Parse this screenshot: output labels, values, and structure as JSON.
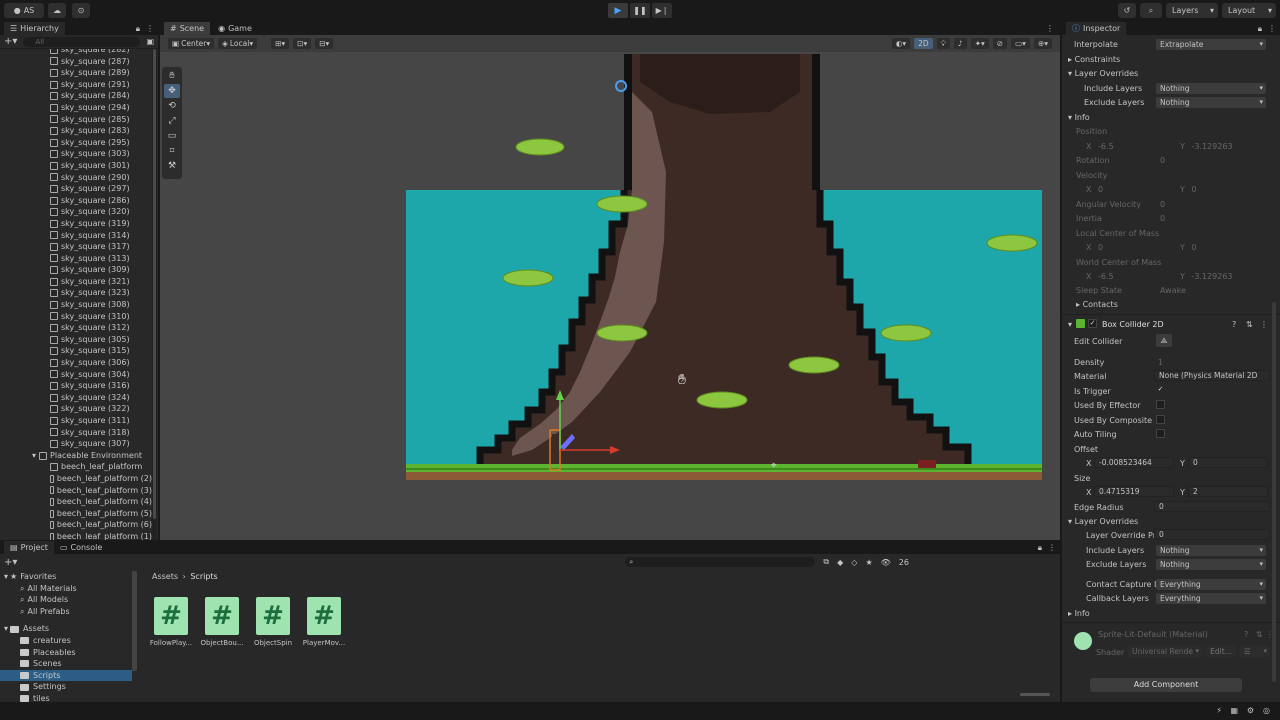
{
  "topbar": {
    "account": "AS",
    "layers_label": "Layers",
    "layout_label": "Layout"
  },
  "hierarchy": {
    "tab_label": "Hierarchy",
    "search_placeholder": "All",
    "items": [
      "sky_square (282)",
      "sky_square (287)",
      "sky_square (289)",
      "sky_square (291)",
      "sky_square (284)",
      "sky_square (294)",
      "sky_square (285)",
      "sky_square (283)",
      "sky_square (295)",
      "sky_square (303)",
      "sky_square (301)",
      "sky_square (290)",
      "sky_square (297)",
      "sky_square (286)",
      "sky_square (320)",
      "sky_square (319)",
      "sky_square (314)",
      "sky_square (317)",
      "sky_square (313)",
      "sky_square (309)",
      "sky_square (321)",
      "sky_square (323)",
      "sky_square (308)",
      "sky_square (310)",
      "sky_square (312)",
      "sky_square (305)",
      "sky_square (315)",
      "sky_square (306)",
      "sky_square (304)",
      "sky_square (316)",
      "sky_square (324)",
      "sky_square (322)",
      "sky_square (311)",
      "sky_square (318)",
      "sky_square (307)"
    ],
    "group_label": "Placeable Environment",
    "children": [
      "beech_leaf_platform",
      "beech_leaf_platform (2)",
      "beech_leaf_platform (3)",
      "beech_leaf_platform (4)",
      "beech_leaf_platform (5)",
      "beech_leaf_platform (6)",
      "beech_leaf_platform (1)"
    ]
  },
  "scene": {
    "tab_scene": "Scene",
    "tab_game": "Game",
    "pivot": "Center",
    "space": "Local",
    "mode_2d": "2D"
  },
  "inspector": {
    "tab_label": "Inspector",
    "interpolate_label": "Interpolate",
    "interpolate_value": "Extrapolate",
    "constraints_label": "Constraints",
    "layer_overrides_label": "Layer Overrides",
    "include_layers_label": "Include Layers",
    "include_layers_value": "Nothing",
    "exclude_layers_label": "Exclude Layers",
    "exclude_layers_value": "Nothing",
    "info_label": "Info",
    "position_label": "Position",
    "position_x": "-6.5",
    "position_y": "-3.129263",
    "rotation_label": "Rotation",
    "rotation_value": "0",
    "velocity_label": "Velocity",
    "velocity_x": "0",
    "velocity_y": "0",
    "angular_velocity_label": "Angular Velocity",
    "angular_velocity_value": "0",
    "inertia_label": "Inertia",
    "inertia_value": "0",
    "local_com_label": "Local Center of Mass",
    "local_com_x": "0",
    "local_com_y": "0",
    "world_com_label": "World Center of Mass",
    "world_com_x": "-6.5",
    "world_com_y": "-3.129263",
    "sleep_state_label": "Sleep State",
    "sleep_state_value": "Awake",
    "contacts_label": "Contacts",
    "box_collider_title": "Box Collider 2D",
    "edit_collider_label": "Edit Collider",
    "density_label": "Density",
    "density_value": "1",
    "material_label": "Material",
    "material_value": "None (Physics Material 2D",
    "is_trigger_label": "Is Trigger",
    "used_by_effector_label": "Used By Effector",
    "used_by_composite_label": "Used By Composite",
    "auto_tiling_label": "Auto Tiling",
    "offset_label": "Offset",
    "offset_x": "-0.008523464",
    "offset_y": "0",
    "size_label": "Size",
    "size_x": "0.4715319",
    "size_y": "2",
    "edge_radius_label": "Edge Radius",
    "edge_radius_value": "0",
    "layer_overrides2_label": "Layer Overrides",
    "layer_override_priority_label": "Layer Override Pri",
    "layer_override_priority_value": "0",
    "include_layers2_label": "Include Layers",
    "include_layers2_value": "Nothing",
    "exclude_layers2_label": "Exclude Layers",
    "exclude_layers2_value": "Nothing",
    "contact_capture_label": "Contact Capture L",
    "contact_capture_value": "Everything",
    "callback_layers_label": "Callback Layers",
    "callback_layers_value": "Everything",
    "info2_label": "Info",
    "material_asset": "Sprite-Lit-Default (Material)",
    "shader_label": "Shader",
    "shader_value": "Universal Rende",
    "shader_edit": "Edit...",
    "add_component": "Add Component"
  },
  "project": {
    "tab_project": "Project",
    "tab_console": "Console",
    "favorites_label": "Favorites",
    "favorites": [
      "All Materials",
      "All Models",
      "All Prefabs"
    ],
    "assets_label": "Assets",
    "folders": [
      "creatures",
      "Placeables",
      "Scenes",
      "Scripts",
      "Settings",
      "tiles"
    ],
    "breadcrumb_root": "Assets",
    "breadcrumb_current": "Scripts",
    "files": [
      "FollowPlay...",
      "ObjectBou...",
      "ObjectSpin",
      "PlayerMov..."
    ],
    "hidden_count": "26"
  },
  "colors": {
    "sky": "#1ea7ab",
    "grass": "#5cb531",
    "dirt": "#8b5a36",
    "trunk_dark": "#3d2a25",
    "trunk_light": "#6e5650",
    "leaf": "#8dc63f",
    "accent": "#3a79bd",
    "script_icon": "#9fe3b0"
  }
}
